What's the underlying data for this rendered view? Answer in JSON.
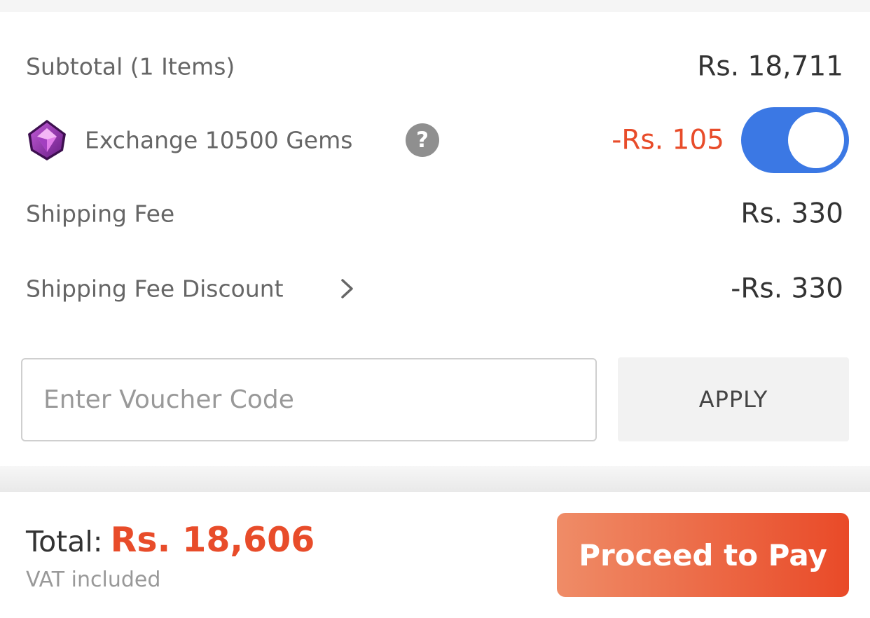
{
  "summary": {
    "subtotal_label": "Subtotal (1 Items)",
    "subtotal_value": "Rs. 18,711",
    "gems_label": "Exchange 10500 Gems",
    "gems_help_glyph": "?",
    "gems_discount": "-Rs. 105",
    "gems_toggle_on": true,
    "shipping_label": "Shipping Fee",
    "shipping_value": "Rs. 330",
    "shipping_discount_label": "Shipping Fee Discount",
    "shipping_discount_value": "-Rs. 330"
  },
  "voucher": {
    "placeholder": "Enter Voucher Code",
    "value": "",
    "apply_label": "APPLY"
  },
  "footer": {
    "total_label": "Total:",
    "total_value": "Rs. 18,606",
    "vat_note": "VAT included",
    "pay_label": "Proceed to Pay"
  },
  "icons": {
    "gem": "gem-icon",
    "help": "help-icon",
    "chevron": "chevron-right-icon"
  },
  "colors": {
    "accent": "#e84c2a",
    "toggle_on": "#3b78e4",
    "pay_gradient_start": "#ef8c67",
    "pay_gradient_end": "#e94a28"
  }
}
